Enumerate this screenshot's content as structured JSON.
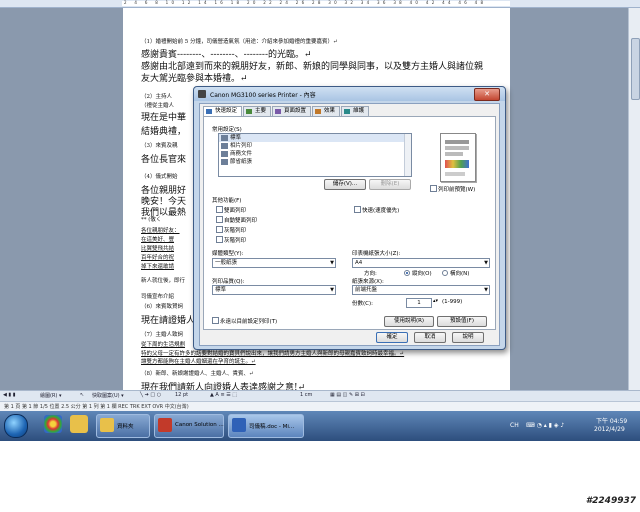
{
  "ruler": {
    "ticks": "2 4 6 8 10 12 14 16 18 20 22 24 26 28 30 32 34 36 38 40 42 44 46 48"
  },
  "document": {
    "lines": [
      "（1）婚禮開始前 5 分鐘，司儀營造氣氛（用途：介紹來參加婚禮的重要嘉賓）↵",
      "感謝貴賓--------、--------、--------的光臨。↵",
      "感謝由北部遠到而來的親朋好友，新郎、新娘的同學與同事，以及雙方主婚人與諸位親",
      "友大駕光臨參與本婚禮。↵",
      "（2）主持人",
      "（禮從主婚人",
      "現在是中華",
      "結婚典禮，",
      "（3）來賓及親",
      "各位長官來",
      "（4）儀式開始",
      "各位親朋好",
      "晚安！今天",
      "我們以最熱",
      "** (敬く",
      "各位親朋好友：",
      "在這美好、豐",
      "比翼雙飛共結",
      "百年好合的祝",
      "掉下來還敢請",
      "新人就位後，即行",
      "司儀宣布介紹",
      "（6）來賓致賀詞",
      "現在請證婚人",
      "（7）主婚人致詞",
      "從下周的生活規劃",
      "特的父母一定有許多的話要對結婚的寶貝們說出來，讓我們請男方主婚人與新郎的母親嘉賓致詞時最幸福。↵",
      "讓雙方都能夠在主婚人婚姻還在孕育的誕生。↵",
      "（8）新郎、新娘謝證婚人、主婚人、貴賓、↵",
      "現在我們請新人向證婚人表達感謝之意!↵"
    ],
    "highlight_word": "司儀"
  },
  "dialog": {
    "title": "Canon MG3100 series Printer - 內容",
    "close_label": "✕",
    "tabs": [
      {
        "label": "快速設定",
        "color": "#3a6fb5"
      },
      {
        "label": "主要",
        "color": "#4a8a3c"
      },
      {
        "label": "頁面設置",
        "color": "#7a5aa8"
      },
      {
        "label": "效果",
        "color": "#c0782a"
      },
      {
        "label": "維護",
        "color": "#2a8a8a"
      }
    ],
    "common_settings_label": "常用設定(S)",
    "common_settings": [
      {
        "label": "標準",
        "selected": true
      },
      {
        "label": "相片列印",
        "selected": false
      },
      {
        "label": "商務文件",
        "selected": false
      },
      {
        "label": "節省紙張",
        "selected": false
      }
    ],
    "save_button": "儲存(V)...",
    "delete_button": "刪除(E)",
    "preview_checkbox": "列印前預覽(W)",
    "additional_features_label": "其他功能(F)",
    "features_left": [
      "雙面列印",
      "自動雙面列印",
      "灰階列印",
      "灰階列印"
    ],
    "feature_right": "快速(速度優先)",
    "media_type_label": "媒體類型(Y):",
    "media_type_value": "一般紙張",
    "paper_size_label": "印表機紙張大小(Z):",
    "paper_size_value": "A4",
    "orientation_label": "方向:",
    "orientation_portrait": "縱向(O)",
    "orientation_landscape": "橫向(N)",
    "print_quality_label": "列印品質(Q):",
    "print_quality_value": "標準",
    "paper_source_label": "紙張來源(X):",
    "paper_source_value": "前端托盤",
    "copies_label": "份數(C):",
    "copies_value": "1",
    "copies_range": "(1-999)",
    "always_print_checkbox": "永遠以目前設定列印(T)",
    "instructions_button": "使用說明(R)",
    "defaults_button": "預設值(F)",
    "ok_button": "確定",
    "cancel_button": "取消",
    "help_button": "說明"
  },
  "drawbar": {
    "draw_label": "繪圖(R) ▾",
    "shapes_label": "快取圖案(U) ▾",
    "font_size": "12 pt",
    "extra": "1 cm"
  },
  "statusbar": {
    "text": "第 1 頁  第 1 節  1/5   位置 2.5 公分  第 1 列  第 1 欄   REC  TRK  EXT  OVR   中文(台灣)"
  },
  "taskbar": {
    "buttons": [
      {
        "label": "資料夾",
        "icon_color": "#e8c04a"
      },
      {
        "label": "Canon Solution ...",
        "icon_color": "#c23a2a"
      },
      {
        "label": "司儀稿.doc - Mi...",
        "icon_color": "#2f61b7"
      }
    ],
    "tray_lang": "CH",
    "time": "下午 04:59",
    "date": "2012/4/29"
  },
  "watermark": "#2249937"
}
